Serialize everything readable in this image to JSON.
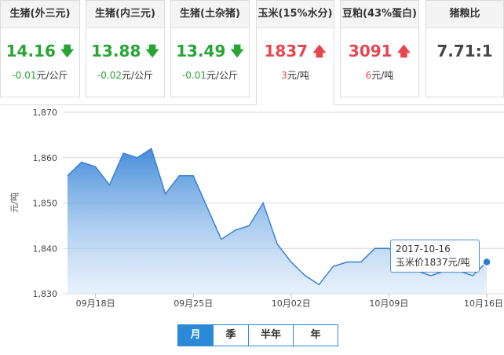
{
  "cards": [
    {
      "title": "生猪(外三元)",
      "price": "14.16",
      "change": "-0.01",
      "unit": "元/公斤",
      "direction": "down"
    },
    {
      "title": "生猪(内三元)",
      "price": "13.88",
      "change": "-0.02",
      "unit": "元/公斤",
      "direction": "down"
    },
    {
      "title": "生猪(土杂猪)",
      "price": "13.49",
      "change": "-0.01",
      "unit": "元/公斤",
      "direction": "down"
    },
    {
      "title": "玉米(15%水分)",
      "price": "1837",
      "change": "3",
      "unit": "元/吨",
      "direction": "up"
    },
    {
      "title": "豆粕(43%蛋白)",
      "price": "3091",
      "change": "6",
      "unit": "元/吨",
      "direction": "up"
    },
    {
      "title": "猪粮比",
      "price": "7.71:1"
    }
  ],
  "colors": {
    "down": "#27a534",
    "up": "#e8464f",
    "accent": "#2a8ad8"
  },
  "icons": {
    "down": "arrow-down-icon",
    "up": "arrow-up-icon"
  },
  "period_buttons": [
    "月",
    "季",
    "半年",
    "年"
  ],
  "selected_period": "月",
  "tooltip": {
    "date": "2017-10-16",
    "text": "玉米价1837元/吨"
  },
  "chart_data": {
    "type": "area",
    "ylabel": "元/吨",
    "ylim": [
      1830,
      1870
    ],
    "yticks": [
      "1,870",
      "1,860",
      "1,850",
      "1,840",
      "1,830"
    ],
    "xticks": [
      "09月18日",
      "09月25日",
      "10月02日",
      "10月09日",
      "10月16日"
    ],
    "x": [
      "2017-09-16",
      "2017-09-17",
      "2017-09-18",
      "2017-09-19",
      "2017-09-20",
      "2017-09-21",
      "2017-09-22",
      "2017-09-23",
      "2017-09-24",
      "2017-09-25",
      "2017-09-26",
      "2017-09-27",
      "2017-09-28",
      "2017-09-29",
      "2017-09-30",
      "2017-10-01",
      "2017-10-02",
      "2017-10-03",
      "2017-10-04",
      "2017-10-05",
      "2017-10-06",
      "2017-10-07",
      "2017-10-08",
      "2017-10-09",
      "2017-10-10",
      "2017-10-11",
      "2017-10-12",
      "2017-10-13",
      "2017-10-14",
      "2017-10-15",
      "2017-10-16"
    ],
    "values": [
      1856,
      1859,
      1858,
      1854,
      1861,
      1860,
      1862,
      1852,
      1856,
      1856,
      1849,
      1842,
      1844,
      1845,
      1850,
      1841,
      1837,
      1834,
      1832,
      1836,
      1837,
      1837,
      1840,
      1840,
      1838,
      1835,
      1834,
      1835,
      1835,
      1834,
      1837
    ],
    "series": [
      {
        "name": "玉米价",
        "values": [
          1856,
          1859,
          1858,
          1854,
          1861,
          1860,
          1862,
          1852,
          1856,
          1856,
          1849,
          1842,
          1844,
          1845,
          1850,
          1841,
          1837,
          1834,
          1832,
          1836,
          1837,
          1837,
          1840,
          1840,
          1838,
          1835,
          1834,
          1835,
          1835,
          1834,
          1837
        ]
      }
    ],
    "grid": true,
    "highlight": {
      "x": "2017-10-16",
      "y": 1837
    }
  }
}
